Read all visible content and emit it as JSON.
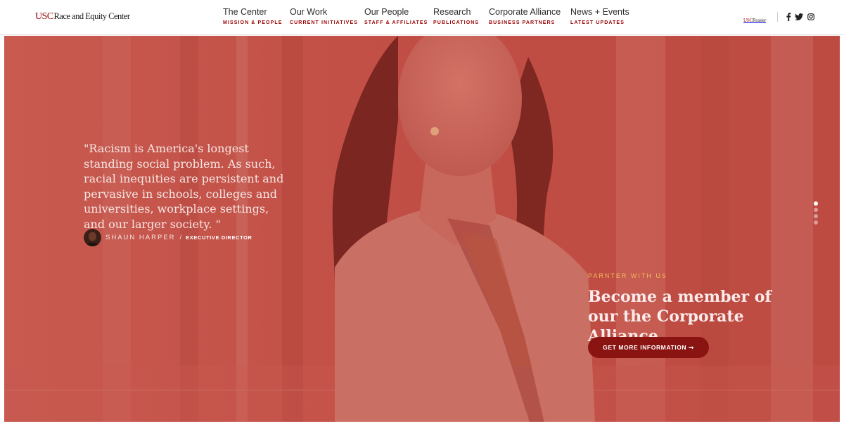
{
  "brand": {
    "logo_usc": "USC",
    "logo_name": "Race and Equity Center"
  },
  "nav": [
    {
      "title": "The Center",
      "subtitle": "MISSION & PEOPLE"
    },
    {
      "title": "Our Work",
      "subtitle": "CURRENT INITIATIVES"
    },
    {
      "title": "Our People",
      "subtitle": "STAFF & AFFILIATES"
    },
    {
      "title": "Research",
      "subtitle": "PUBLICATIONS"
    },
    {
      "title": "Corporate Alliance",
      "subtitle": "BUSINESS PARTNERS"
    },
    {
      "title": "News + Events",
      "subtitle": "LATEST UPDATES"
    }
  ],
  "partner_logo": {
    "usc": "USC",
    "name": "Rossier"
  },
  "social": [
    "facebook-icon",
    "twitter-icon",
    "instagram-icon"
  ],
  "hero": {
    "quote": "\"Racism is America's longest standing social problem. As such, racial inequities are persistent and pervasive in schools, colleges and universities, workplace settings, and our larger society. \"",
    "author_name": "SHAUN HARPER",
    "author_separator": "/",
    "author_role": "EXECUTIVE DIRECTOR",
    "eyebrow": "PARNTER WITH US",
    "cta_heading": "Become a member of our the Corporate Alliance",
    "cta_button": "GET MORE INFORMATION ➞",
    "slide_count": 4,
    "active_slide": 1
  },
  "colors": {
    "brand_red": "#990000",
    "overlay_red": "#c04d44",
    "button_red": "#8a1412",
    "eyebrow_gold": "#f3bb57"
  }
}
